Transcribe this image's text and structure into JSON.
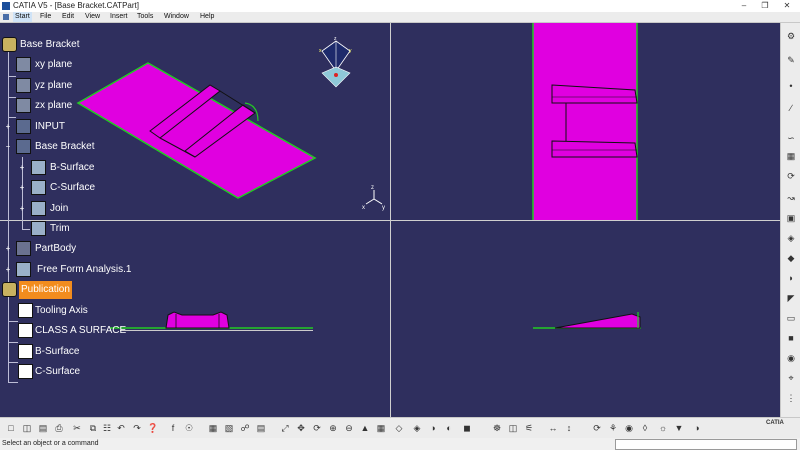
{
  "window": {
    "title": "CATIA V5 - [Base Bracket.CATPart]"
  },
  "menu": [
    "Start",
    "File",
    "Edit",
    "View",
    "Insert",
    "Tools",
    "Window",
    "Help"
  ],
  "tree": [
    {
      "label": "Base Bracket"
    },
    {
      "label": "xy plane"
    },
    {
      "label": "yz plane"
    },
    {
      "label": "zx plane"
    },
    {
      "label": "INPUT"
    },
    {
      "label": "Base Bracket"
    },
    {
      "label": "B-Surface"
    },
    {
      "label": "C-Surface"
    },
    {
      "label": "Join"
    },
    {
      "label": "Trim"
    },
    {
      "label": "PartBody"
    },
    {
      "label": "Free Form Analysis.1"
    },
    {
      "label": "Publication"
    },
    {
      "label": "Tooling Axis"
    },
    {
      "label": "CLASS A SURFACE"
    },
    {
      "label": "B-Surface"
    },
    {
      "label": "C-Surface"
    }
  ],
  "compass": {
    "x": "x",
    "y": "y",
    "z": "z"
  },
  "axis_triad": {
    "x": "x",
    "y": "y",
    "z": "z"
  },
  "status": {
    "message": "Select an object or a command"
  },
  "brand": {
    "logo": "CATIA"
  },
  "colors": {
    "surface": "#e000e0",
    "edge": "#22cc22",
    "background": "#2f2f5e",
    "selection": "#f28c1e"
  }
}
